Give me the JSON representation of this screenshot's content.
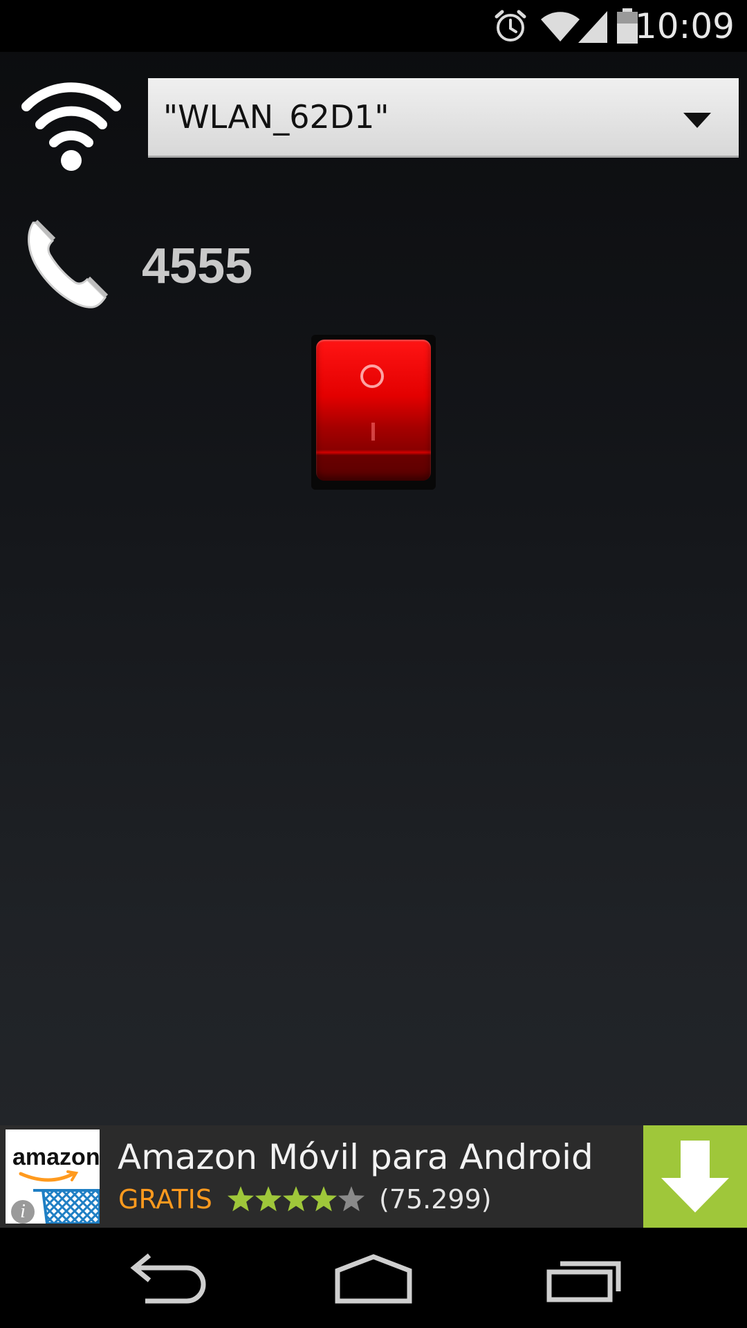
{
  "status_bar": {
    "time": "10:09",
    "icons": [
      "alarm-icon",
      "wifi-icon",
      "signal-icon",
      "battery-icon"
    ]
  },
  "wifi": {
    "icon": "wifi-icon",
    "selected_network": "\"WLAN_62D1\""
  },
  "phone": {
    "icon": "phone-icon",
    "number": "4555"
  },
  "power_switch": {
    "icon": "rocker-switch-icon",
    "color": "#e00000"
  },
  "ad": {
    "logo_text": "amazon",
    "title": "Amazon Móvil para Android",
    "price": "GRATIS",
    "rating": 4,
    "rating_max": 5,
    "reviews": "(75.299)",
    "download_icon": "download-arrow-icon",
    "accent_color": "#9fc73a",
    "price_color": "#ff9a1e"
  },
  "nav_bar": {
    "icons": [
      "back-icon",
      "home-icon",
      "recents-icon"
    ]
  }
}
